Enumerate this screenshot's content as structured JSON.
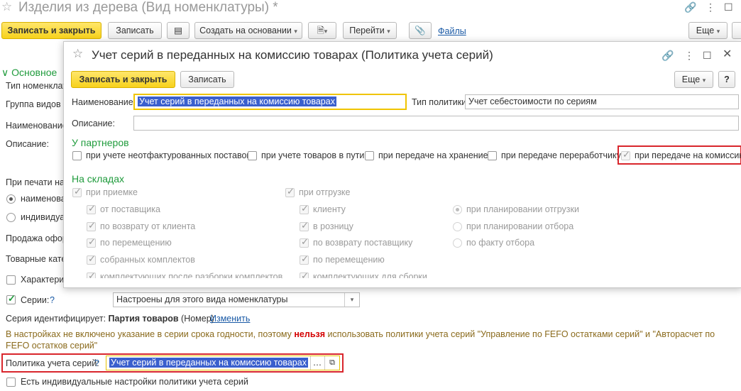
{
  "main": {
    "title": "Изделия из дерева (Вид номенклатуры) *",
    "toolbar": {
      "save_close": "Записать и закрыть",
      "save": "Записать",
      "create_based": "Создать на основании",
      "go": "Перейти",
      "files": "Файлы",
      "more": "Еще"
    },
    "section_title": "Основное",
    "left_labels": [
      "Тип номенклату",
      "Группа видов н",
      "Наименование",
      "Описание:"
    ],
    "print_label": "При печати наи",
    "radio_1": "наименова",
    "radio_2": "индивидуал",
    "sales_label": "Продажа офор",
    "goods_cat_label": "Товарные кате",
    "characteristics_label": "Характери",
    "series_label": "Серии:",
    "series_help": "?",
    "series_value": "Настроены для этого вида номенклатуры",
    "series_identifies_label": "Серия идентифицирует:",
    "series_identifies_value": "Партия товаров",
    "series_identifies_suffix": "(Номер)",
    "change_link": "Изменить",
    "warning_part1": "В настройках не включено указание в серии срока годности, поэтому ",
    "warning_bold": "нельзя",
    "warning_part2": " использовать политики учета серий \"Управление по FEFO остатками серий\" и \"Авторасчет по FEFO остатков серий\"",
    "policy_label": "Политика учета серий:",
    "policy_help": "?",
    "policy_value": "Учет серий в переданных на комиссию товарах",
    "individual_settings": "Есть индивидуальные настройки политики учета серий"
  },
  "dialog": {
    "title": "Учет серий в переданных на комиссию товарах (Политика учета серий)",
    "save_close": "Записать и закрыть",
    "save": "Записать",
    "more": "Еще",
    "help": "?",
    "name_label": "Наименование:",
    "name_value": "Учет серий в переданных на комиссию товарах",
    "policy_type_label": "Тип политики:",
    "policy_type_value": "Учет себестоимости по сериям",
    "description_label": "Описание:",
    "partners_title": "У партнеров",
    "partners": [
      "при учете неотфактурованных поставок",
      "при учете товаров в пути",
      "при передаче на хранение",
      "при передаче переработчику",
      "при передаче на комиссию"
    ],
    "warehouses_title": "На складах",
    "on_receipt": "при приемке",
    "on_shipment": "при отгрузке",
    "receipt_items": [
      "от поставщика",
      "по возврату от клиента",
      "по перемещению",
      "собранных комплектов",
      "комплектующих после разборки комплектов"
    ],
    "shipment_items": [
      "клиенту",
      "в розницу",
      "по возврату поставщику",
      "по перемещению",
      "комплектующих для сборки"
    ],
    "radio_items": [
      "при планировании отгрузки",
      "при планировании отбора",
      "по факту отбора"
    ]
  }
}
